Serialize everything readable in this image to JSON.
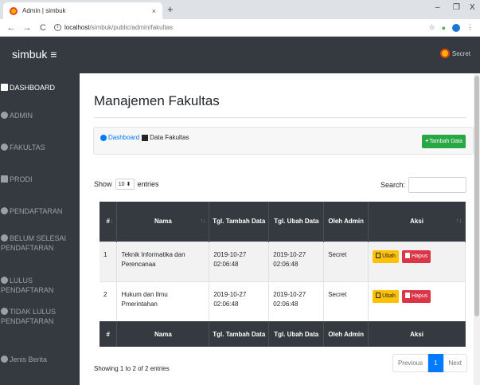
{
  "browser": {
    "tab_title": "Admin | simbuk",
    "tab_close": "×",
    "new_tab": "+",
    "url_host": "localhost",
    "url_path": "/simbuk/public/admin/fakultas",
    "minimize": "–",
    "maximize": "❐",
    "close": "X"
  },
  "navbar": {
    "brand": "simbuk ≡",
    "user": "Secret"
  },
  "sidebar": {
    "items": [
      {
        "label": "DASHBOARD",
        "icon": "dashboard-icon"
      },
      {
        "label": "ADMIN",
        "icon": "user-icon"
      },
      {
        "label": "FAKULTAS",
        "icon": "user-icon"
      },
      {
        "label": "PRODI",
        "icon": "edit-icon"
      },
      {
        "label": "PENDAFTARAN",
        "icon": "user-icon"
      },
      {
        "label": "BELUM SELESAI",
        "label2": "PENDAFTARAN",
        "icon": "user-icon"
      },
      {
        "label": "LULUS PENDAFTARAN",
        "icon": "user-icon"
      },
      {
        "label": "TIDAK LULUS",
        "label2": "PENDAFTARAN",
        "icon": "user-icon"
      },
      {
        "label": "Jenis Berita",
        "icon": "user-icon"
      }
    ]
  },
  "main": {
    "title": "Manajemen Fakultas",
    "breadcrumb": {
      "home": "Dashboard",
      "current": "Data Fakultas"
    },
    "add_button": "Tambah Data",
    "show_label": "Show",
    "entries_value": "10",
    "entries_label": "entries",
    "search_label": "Search:",
    "columns": [
      "#",
      "Nama",
      "Tgl. Tambah Data",
      "Tgl. Ubah Data",
      "Oleh Admin",
      "Aksi"
    ],
    "rows": [
      {
        "no": "1",
        "nama": "Teknik Informatika dan Perencanaa",
        "tgl_tambah": "2019-10-27 02:06:48",
        "tgl_ubah": "2019-10-27 02:06:48",
        "admin": "Secret"
      },
      {
        "no": "2",
        "nama": "Hukum dan Ilmu Pmerintahan",
        "tgl_tambah": "2019-10-27 02:06:48",
        "tgl_ubah": "2019-10-27 02:06:48",
        "admin": "Secret"
      }
    ],
    "edit_label": "Ubah",
    "delete_label": "Hapus",
    "info": "Showing 1 to 2 of 2 entries",
    "pager": {
      "prev": "Previous",
      "current": "1",
      "next": "Next"
    }
  }
}
